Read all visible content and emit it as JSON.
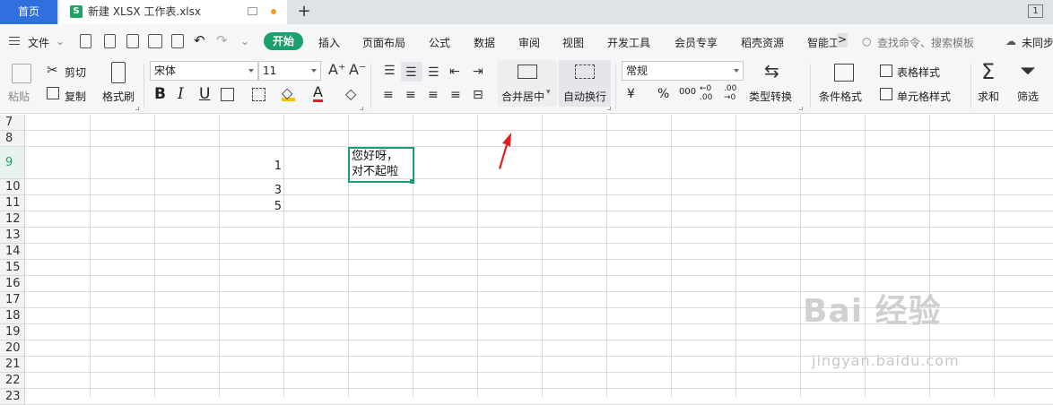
{
  "titlebar": {
    "home_tab": "首页",
    "doc_tab_icon": "S",
    "doc_tab": "新建 XLSX 工作表.xlsx",
    "new_tab": "+",
    "page_indicator": "1"
  },
  "menubar": {
    "file": "文件",
    "start": "开始",
    "insert": "插入",
    "page_layout": "页面布局",
    "formula": "公式",
    "data": "数据",
    "review": "审阅",
    "view": "视图",
    "dev_tools": "开发工具",
    "member": "会员专享",
    "resources": "稻壳资源",
    "smart": "智能工",
    "more": ">",
    "search": "查找命令、搜索模板",
    "sync": "未同步"
  },
  "ribbon": {
    "paste": "粘贴",
    "cut": "剪切",
    "copy": "复制",
    "format_painter": "格式刷",
    "font_name": "宋体",
    "font_size": "11",
    "bold": "B",
    "italic": "I",
    "underline": "U",
    "font_color_letter": "A",
    "merge_center": "合并居中",
    "wrap_text": "自动换行",
    "number_format": "常规",
    "currency": "¥",
    "percent": "%",
    "thousands": "000",
    "dec_inc": "←0 .00",
    "dec_dec": ".00 →0",
    "type_convert": "类型转换",
    "cond_format": "条件格式",
    "table_style": "表格样式",
    "cell_style": "单元格样式",
    "sum": "求和",
    "filter": "筛选"
  },
  "sheet": {
    "rows": [
      "7",
      "8",
      "9",
      "10",
      "11",
      "12",
      "13",
      "14",
      "15",
      "16",
      "17",
      "18",
      "19",
      "20",
      "21",
      "22",
      "23"
    ],
    "cells": {
      "e9": "1",
      "e10": "3",
      "e11": "5"
    },
    "selected_line1": "您好呀，",
    "selected_line2": "对不起啦"
  },
  "watermark": {
    "main": "Bai 经验",
    "sub": "jingyan.baidu.com"
  },
  "colors": {
    "accent": "#1aa06d",
    "home_tab": "#2f6fde",
    "arrow": "#e02020"
  }
}
